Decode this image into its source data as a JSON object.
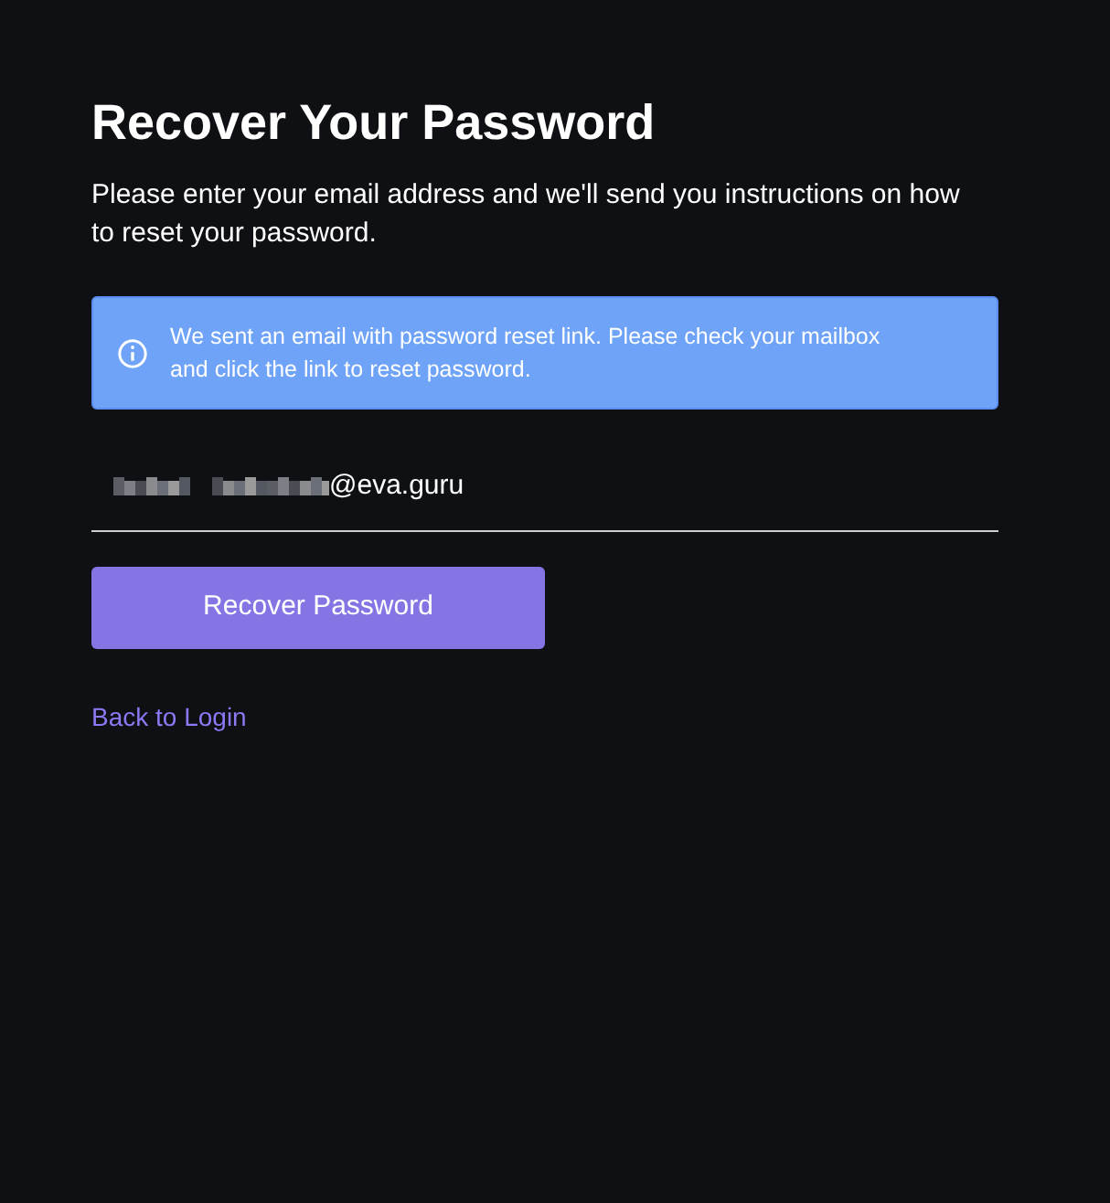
{
  "title": "Recover Your Password",
  "description": "Please enter your email address and we'll send you instructions on how to reset your password.",
  "alert": {
    "kind": "info",
    "text": "We sent an email with password reset link. Please check your mailbox and click the link to reset password."
  },
  "email_field": {
    "value": "@eva.guru",
    "redacted": true
  },
  "submit_button": "Recover Password",
  "back_link": "Back to Login"
}
